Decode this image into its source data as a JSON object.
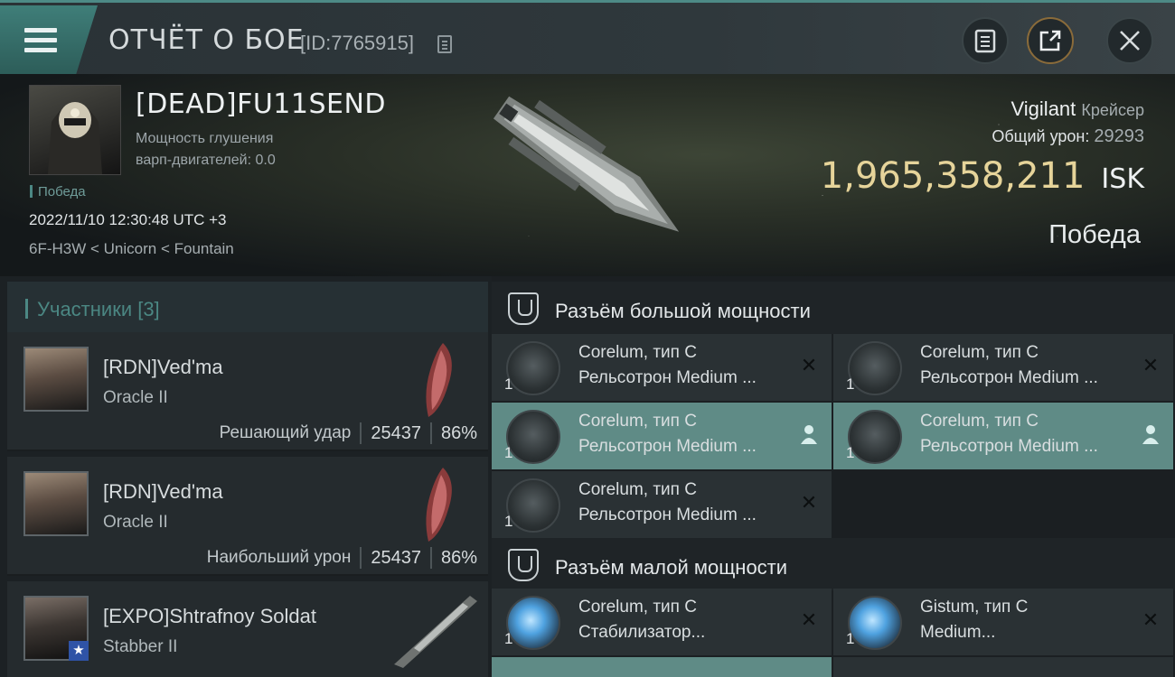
{
  "topbar": {
    "title": "ОТЧЁТ О БОЕ",
    "id_label": "[ID:7765915]",
    "icons": {
      "menu": "menu-icon",
      "copy": "copy-icon",
      "clipboard": "clipboard-icon",
      "share": "share-icon",
      "close": "close-icon"
    }
  },
  "victim": {
    "name": "[DEAD]FU11SEND",
    "warp_line1": "Мощность глушения",
    "warp_line2": "варп-двигателей: 0.0",
    "result_badge": "Победа",
    "timestamp": "2022/11/10 12:30:48 UTC +3",
    "location": "6F-H3W < Unicorn < Fountain",
    "ship": "Vigilant",
    "ship_class": "Крейсер",
    "damage_label": "Общий урон:",
    "damage_value": "29293",
    "isk_value": "1,965,358,211",
    "isk_unit": "ISK",
    "outcome": "Победа"
  },
  "participants": {
    "header": "Участники [3]",
    "rows": [
      {
        "name": "[RDN]Ved'ma",
        "ship": "Oracle II",
        "role": "Решающий удар",
        "damage": "25437",
        "percent": "86%"
      },
      {
        "name": "[RDN]Ved'ma",
        "ship": "Oracle II",
        "role": "Наибольший урон",
        "damage": "25437",
        "percent": "86%"
      },
      {
        "name": "[EXPO]Shtrafnoy Soldat",
        "ship": "Stabber II"
      }
    ]
  },
  "fittings": {
    "high_slot_title": "Разъём большой мощности",
    "low_slot_title": "Разъём малой мощности",
    "high": [
      {
        "name": "Corelum, тип C",
        "type": "Рельсотрон Medium ...",
        "qty": "1",
        "state": "destroyed"
      },
      {
        "name": "Corelum, тип C",
        "type": "Рельсотрон Medium ...",
        "qty": "1",
        "state": "destroyed"
      },
      {
        "name": "Corelum, тип C",
        "type": "Рельсотрон Medium ...",
        "qty": "1",
        "state": "dropped"
      },
      {
        "name": "Corelum, тип C",
        "type": "Рельсотрон Medium ...",
        "qty": "1",
        "state": "dropped"
      },
      {
        "name": "Corelum, тип C",
        "type": "Рельсотрон Medium ...",
        "qty": "1",
        "state": "destroyed"
      }
    ],
    "low": [
      {
        "name": "Corelum, тип C",
        "type": "Стабилизатор...",
        "qty": "1",
        "state": "destroyed"
      },
      {
        "name": "Gistum, тип C",
        "type": "Medium...",
        "qty": "1",
        "state": "destroyed"
      }
    ]
  },
  "colors": {
    "accent": "#4c8884",
    "isk": "#e6d49a",
    "active_row": "#5f8b86"
  }
}
